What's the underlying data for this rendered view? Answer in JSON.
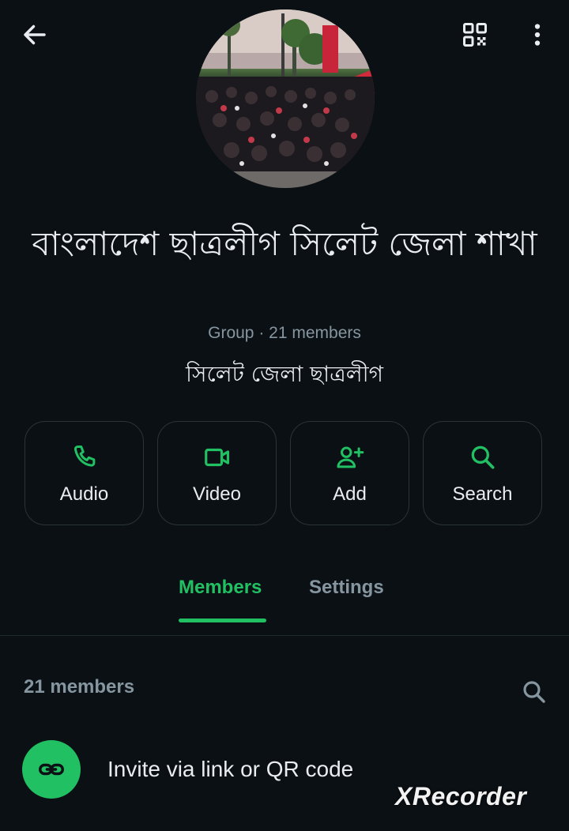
{
  "header": {
    "back_icon": "arrow-left-icon",
    "qr_icon": "qr-code-icon",
    "menu_icon": "more-vertical-icon"
  },
  "group": {
    "name": "বাংলাদেশ ছাত্রলীগ সিলেট জেলা শাখা",
    "meta": "Group · 21 members",
    "description": "সিলেট জেলা ছাত্রলীগ"
  },
  "actions": [
    {
      "label": "Audio",
      "icon": "phone-icon"
    },
    {
      "label": "Video",
      "icon": "video-camera-icon"
    },
    {
      "label": "Add",
      "icon": "add-person-icon"
    },
    {
      "label": "Search",
      "icon": "search-icon"
    }
  ],
  "tabs": {
    "members": "Members",
    "settings": "Settings",
    "active": "Members"
  },
  "members_section": {
    "count_label": "21 members",
    "invite_label": "Invite via link or QR code"
  },
  "watermark": "XRecorder",
  "colors": {
    "background": "#0b1014",
    "accent": "#21c063",
    "text_primary": "#e9edef",
    "text_secondary": "#8696a0"
  }
}
